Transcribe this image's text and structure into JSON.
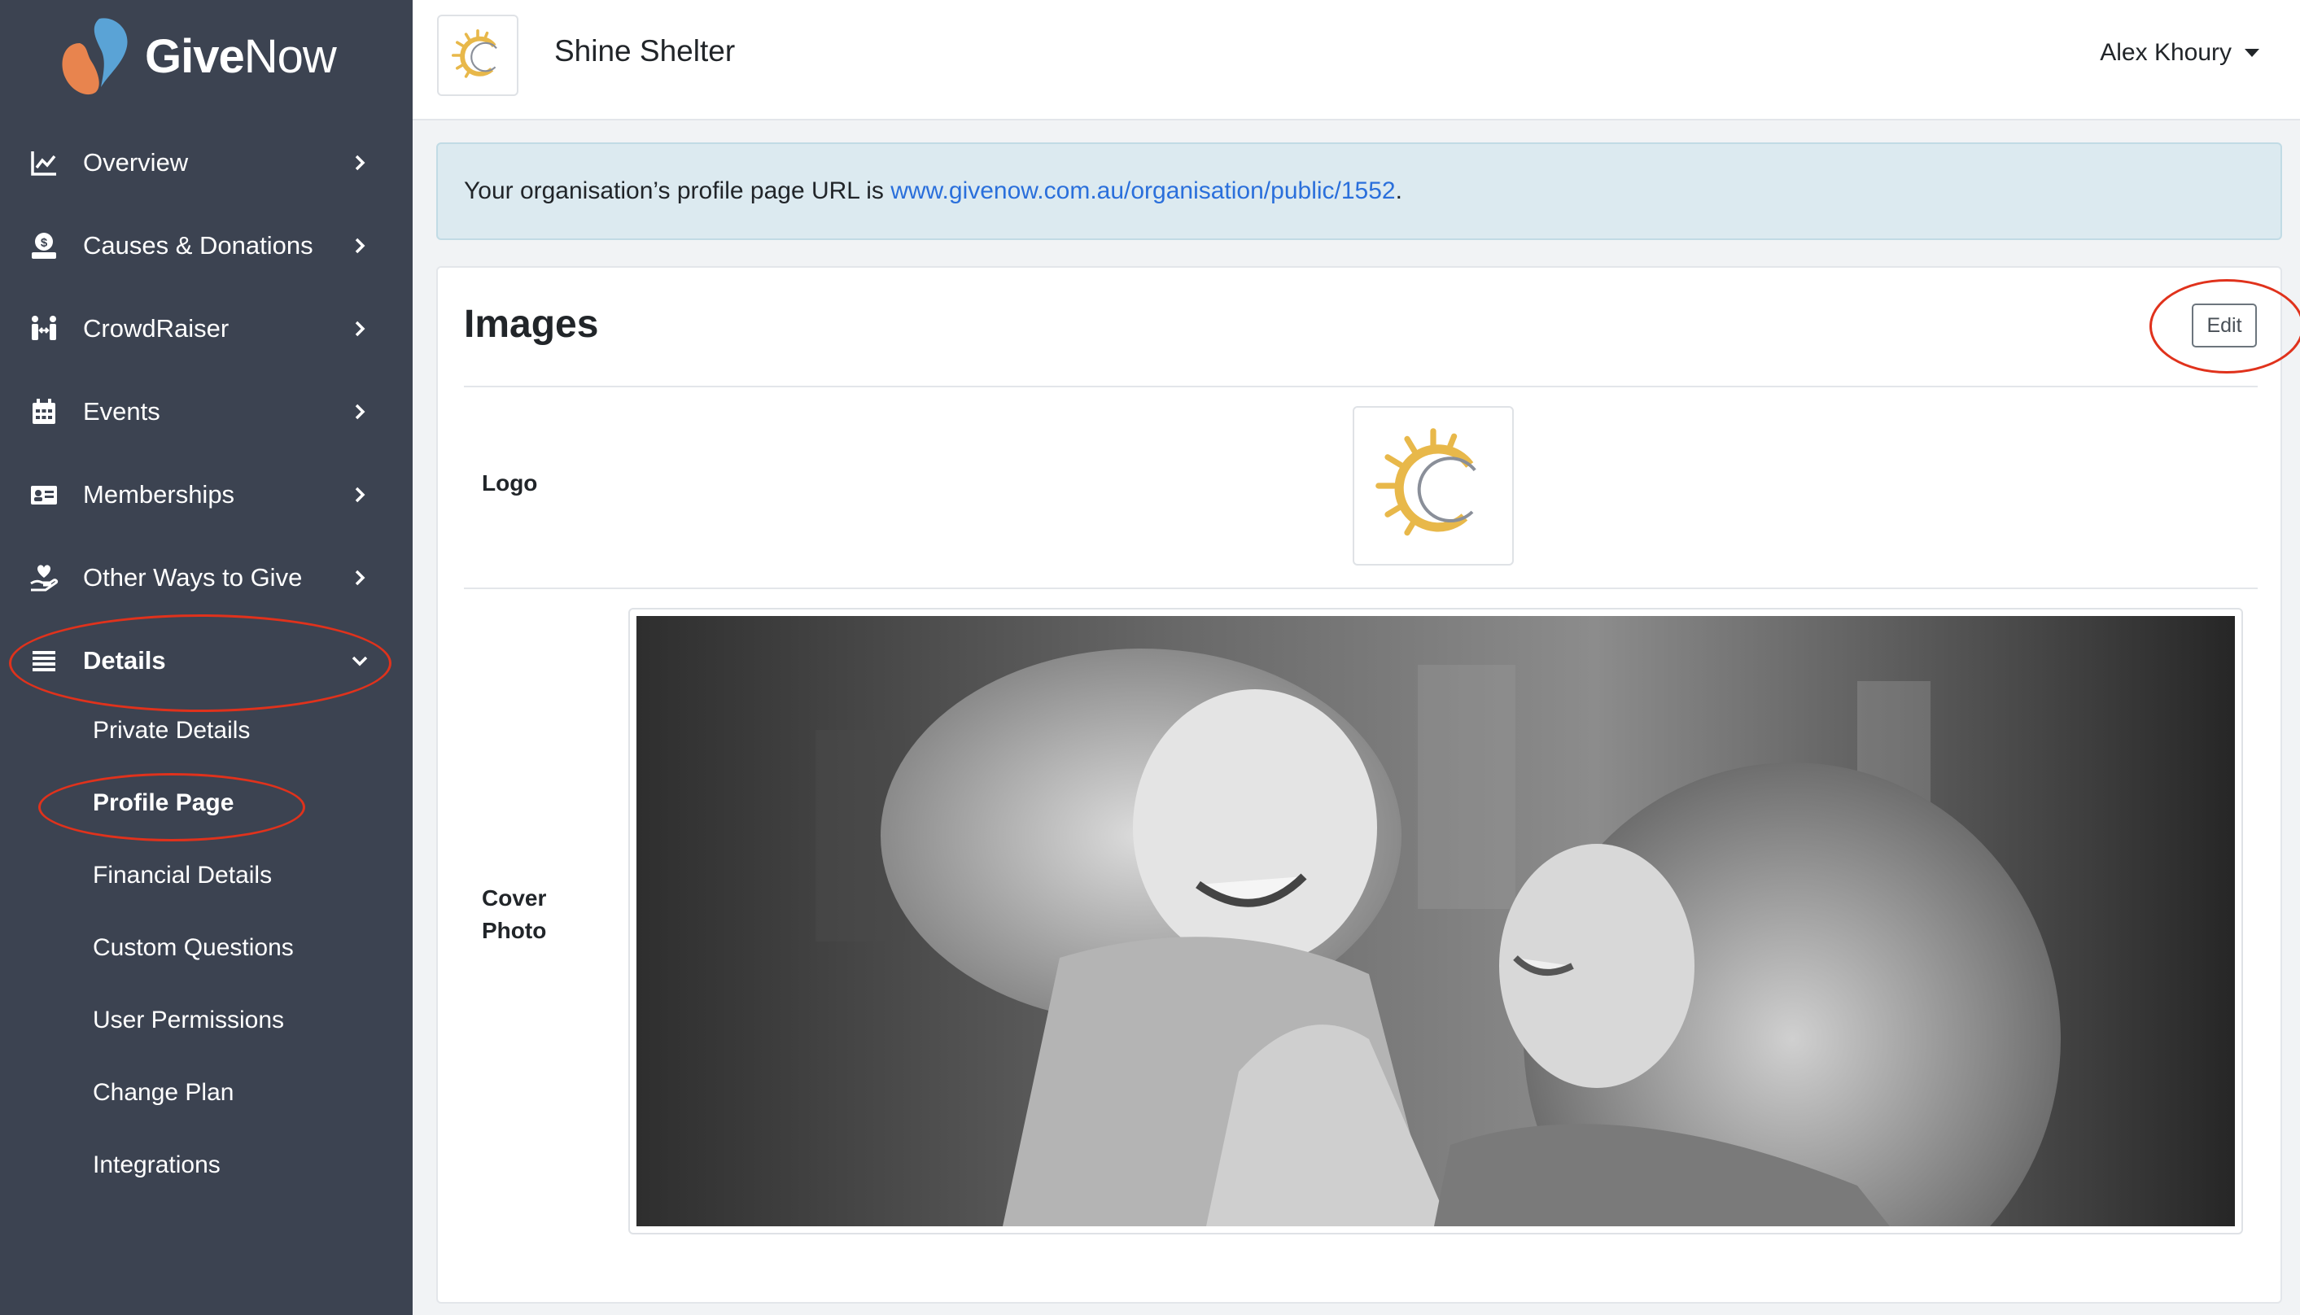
{
  "brand": {
    "name_part1": "Give",
    "name_part2": "Now"
  },
  "sidebar": {
    "items": [
      {
        "label": "Overview",
        "icon": "chart-line-icon"
      },
      {
        "label": "Causes & Donations",
        "icon": "donate-icon"
      },
      {
        "label": "CrowdRaiser",
        "icon": "people-arrows-icon"
      },
      {
        "label": "Events",
        "icon": "calendar-icon"
      },
      {
        "label": "Memberships",
        "icon": "id-card-icon"
      },
      {
        "label": "Other Ways to Give",
        "icon": "hand-holding-heart-icon"
      },
      {
        "label": "Details",
        "icon": "list-icon",
        "expanded": true
      }
    ],
    "sub_items": [
      {
        "label": "Private Details"
      },
      {
        "label": "Profile Page",
        "active": true
      },
      {
        "label": "Financial Details"
      },
      {
        "label": "Custom Questions"
      },
      {
        "label": "User Permissions"
      },
      {
        "label": "Change Plan"
      },
      {
        "label": "Integrations"
      }
    ]
  },
  "header": {
    "org_name": "Shine Shelter",
    "user_name": "Alex Khoury"
  },
  "alert": {
    "prefix": "Your organisation’s profile page URL is ",
    "url": "www.givenow.com.au/organisation/public/1552",
    "suffix": "."
  },
  "images_card": {
    "title": "Images",
    "edit_label": "Edit",
    "logo_label": "Logo",
    "cover_label_line1": "Cover",
    "cover_label_line2": "Photo"
  },
  "colors": {
    "sidebar_bg": "#3c4351",
    "link": "#2a6fdb",
    "alert_bg": "#dceaf0",
    "annotation_ring": "#e0321c",
    "logo_sun": "#e8b84a"
  }
}
